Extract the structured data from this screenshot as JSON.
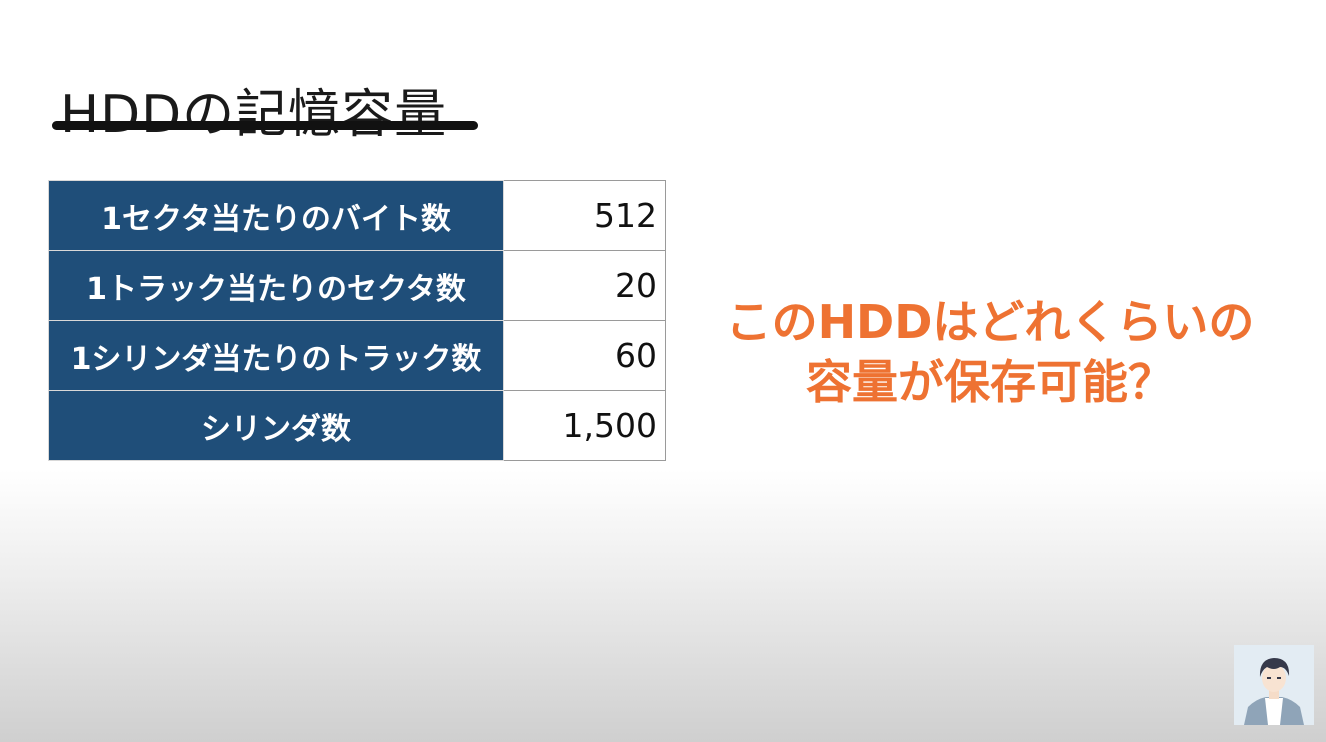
{
  "page": {
    "title": "HDDの記憶容量"
  },
  "spec_table": {
    "rows": [
      {
        "label": "1セクタ当たりのバイト数",
        "value": "512"
      },
      {
        "label": "1トラック当たりのセクタ数",
        "value": "20"
      },
      {
        "label": "1シリンダ当たりのトラック数",
        "value": "60"
      },
      {
        "label": "シリンダ数",
        "value": "1,500"
      }
    ]
  },
  "question": {
    "line1": "このHDDはどれくらいの",
    "line2": "容量が保存可能？"
  },
  "colors": {
    "table_header_bg": "#1f4e79",
    "question_text": "#ee7232",
    "title_text": "#1a1a1a"
  }
}
